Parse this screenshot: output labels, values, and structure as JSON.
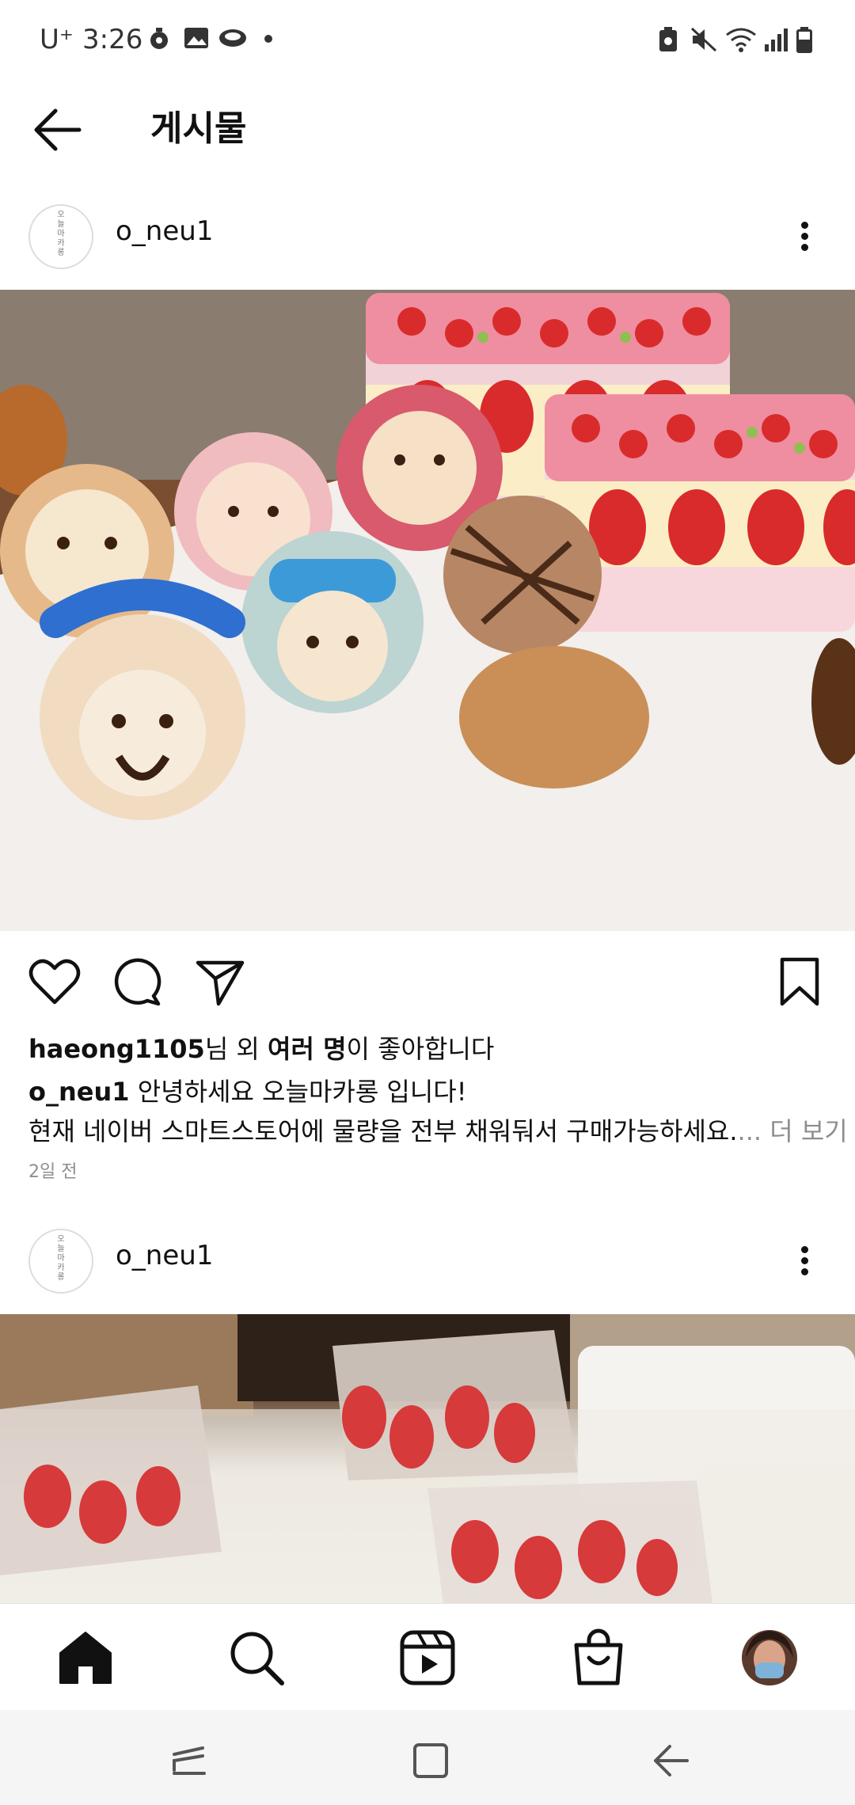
{
  "status_bar": {
    "carrier": "U⁺",
    "time": "3:26",
    "icons": [
      "timer-icon",
      "gallery-icon",
      "cloud-icon",
      "dot-icon",
      "battery-saver-icon",
      "mute-icon",
      "wifi-icon",
      "signal-icon",
      "battery-icon"
    ]
  },
  "header": {
    "title": "게시물",
    "back_icon": "arrow-left-icon"
  },
  "posts": [
    {
      "username": "o_neu1",
      "avatar_text": "오\n늘\n마\n카\n롱",
      "image": "macarons-and-strawberry-cakes",
      "actions": [
        "heart-icon",
        "comment-icon",
        "share-icon",
        "bookmark-icon"
      ],
      "likes": {
        "user": "haeong1105",
        "mid": "님 외 ",
        "many": "여러 명",
        "tail": "이 좋아합니다"
      },
      "caption": {
        "user": "o_neu1",
        "line1": " 안녕하세요 오늘마카롱 입니다!",
        "line2": "현재 네이버 스마트스토어에 물량을 전부 채워둬서 구매가능하세요.",
        "more": "... 더 보기"
      },
      "time": "2일 전"
    },
    {
      "username": "o_neu1",
      "avatar_text": "오\n늘\n마\n카\n롱",
      "image": "strawberry-desserts-in-bags"
    }
  ],
  "bottom_nav": [
    "home-icon",
    "search-icon",
    "reels-icon",
    "shop-icon",
    "profile-avatar"
  ],
  "system_nav": [
    "recents-icon",
    "home-button-icon",
    "back-icon"
  ],
  "colors": {
    "text": "#111111",
    "muted": "#8e8e8e",
    "divider": "#e6e6e6",
    "background": "#ffffff"
  }
}
